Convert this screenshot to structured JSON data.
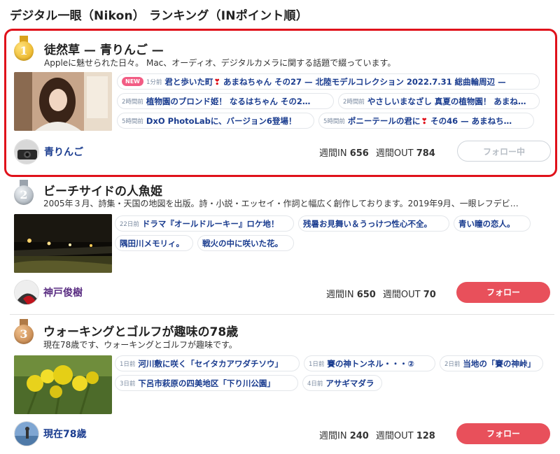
{
  "page": {
    "title": "デジタル一眼（Nikon） ランキング（INポイント順）",
    "colors": {
      "highlight_border": "#e0121b",
      "link": "#1a3c8f",
      "follow_button": "#e8505b",
      "new_badge": "#f25c84"
    }
  },
  "rankings": [
    {
      "rank": "1",
      "medal": "gold",
      "title": "徒然草 — 青りんご —",
      "description": "Appleに魅せられた日々。 Mac、オーディオ、デジタルカメラに関する話題で綴っています。",
      "posts": [
        {
          "badge": "NEW",
          "time": "1分前",
          "title": "君と歩いた町",
          "heart": "❣",
          "title_after": " あまねちゃん その27 — 北陸モデルコレクション 2022.7.31 総曲輪周辺 —"
        },
        {
          "time": "2時間前",
          "title": "植物園のブロンド姫！ なるはちゃん その2…"
        },
        {
          "time": "2時間前",
          "title": "やさしいまなざし 真夏の植物園！ あまねち…"
        },
        {
          "time": "5時間前",
          "title": "DxO PhotoLabに、バージョン6登場！"
        },
        {
          "time": "5時間前",
          "title": "ポニーテールの君に",
          "heart": "❣",
          "title_after": " その46 — あまねち…"
        }
      ],
      "author": "青りんご",
      "author_color": "#1a3c8f",
      "weekly_in_label": "週間IN",
      "weekly_in": "656",
      "weekly_out_label": "週間OUT",
      "weekly_out": "784",
      "follow_label": "フォロー中",
      "follow_state": "following"
    },
    {
      "rank": "2",
      "medal": "silver",
      "title": "ビーチサイドの人魚姫",
      "description": "2005年３月、詩集・天国の地図を出版。詩・小説・エッセイ・作詞と幅広く創作しております。2019年9月、一眼レフデビ…",
      "posts": [
        {
          "time": "22日前",
          "title": "ドラマ『オールドルーキー』ロケ地！"
        },
        {
          "time": "",
          "title": "残暑お見舞い＆うっけつ性心不全。"
        },
        {
          "time": "",
          "title": "青い瞳の恋人。"
        },
        {
          "time": "",
          "title": "隅田川メモリィ。"
        },
        {
          "time": "",
          "title": "戦火の中に咲いた花。"
        }
      ],
      "author": "神戸俊樹",
      "author_color": "#5a2d82",
      "weekly_in_label": "週間IN",
      "weekly_in": "650",
      "weekly_out_label": "週間OUT",
      "weekly_out": "70",
      "follow_label": "フォロー",
      "follow_state": "follow"
    },
    {
      "rank": "3",
      "medal": "bronze",
      "title": "ウォーキングとゴルフが趣味の78歳",
      "description": "現在78歳です、ウォーキングとゴルフが趣味です。",
      "posts": [
        {
          "time": "1日前",
          "title": "河川敷に咲く「セイタカアワダチソウ」"
        },
        {
          "time": "1日前",
          "title": "賽の神トンネル・・・②"
        },
        {
          "time": "2日前",
          "title": "当地の「賽の神峠」"
        },
        {
          "time": "3日前",
          "title": "下呂市萩原の四美地区「下り川公園」"
        },
        {
          "time": "4日前",
          "title": "アサギマダラ"
        }
      ],
      "author": "現在78歳",
      "author_color": "#1a3c8f",
      "weekly_in_label": "週間IN",
      "weekly_in": "240",
      "weekly_out_label": "週間OUT",
      "weekly_out": "128",
      "follow_label": "フォロー",
      "follow_state": "follow"
    }
  ]
}
